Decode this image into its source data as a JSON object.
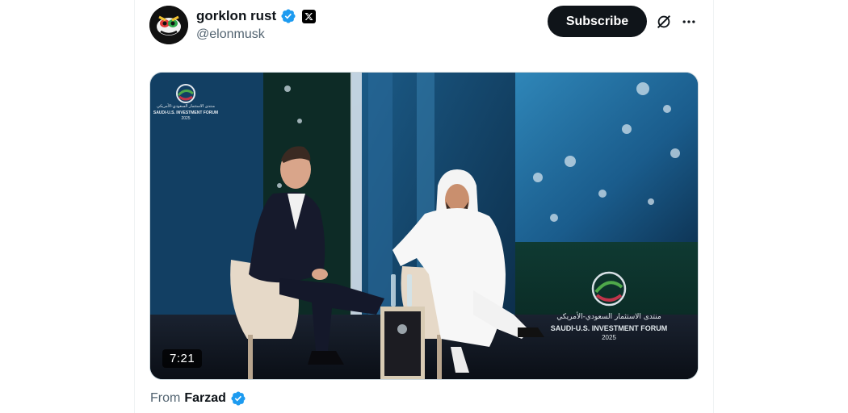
{
  "author": {
    "display_name": "gorklon rust",
    "handle": "@elonmusk",
    "avatar_icon": "avatar-image",
    "verified_icon": "verified-badge-icon",
    "affiliate_icon": "x-logo-icon"
  },
  "header_actions": {
    "subscribe_label": "Subscribe",
    "grok_icon": "grok-icon",
    "more_icon": "more-horizontal-icon"
  },
  "video": {
    "duration": "7:21",
    "event_logo_en": "SAUDI-U.S. INVESTMENT FORUM",
    "event_logo_ar": "منتدى الاستثمار السعودي-الأمريكي",
    "event_year": "2025"
  },
  "source": {
    "from_label": "From",
    "name": "Farzad",
    "verified_icon": "verified-badge-icon"
  },
  "colors": {
    "verified_blue": "#1d9bf0",
    "subscribe_bg": "#0f1419",
    "secondary_text": "#536471"
  }
}
